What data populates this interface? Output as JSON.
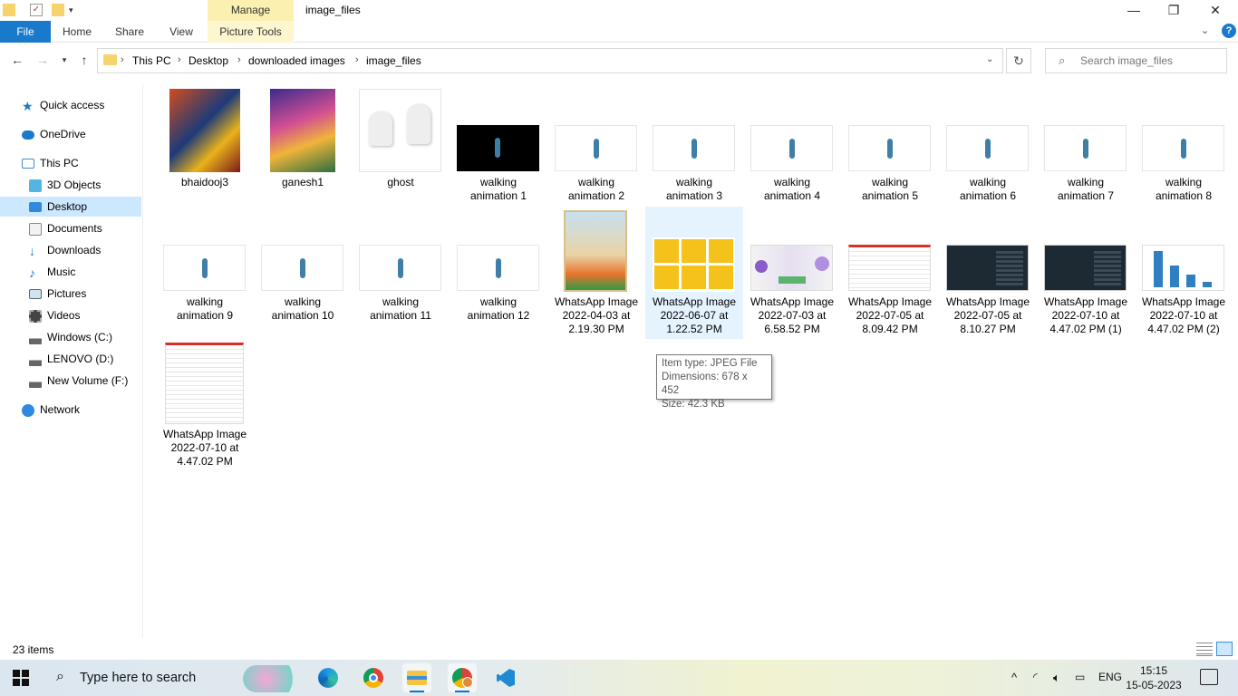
{
  "titlebar": {
    "contextual_tab": "Manage",
    "window_title": "image_files",
    "minimize_glyph": "—",
    "maximize_glyph": "❐",
    "close_glyph": "✕"
  },
  "ribbon": {
    "file": "File",
    "home": "Home",
    "share": "Share",
    "view": "View",
    "picture_tools": "Picture Tools",
    "help_glyph": "?"
  },
  "address": {
    "crumbs": [
      "This PC",
      "Desktop",
      "downloaded images",
      "image_files"
    ],
    "sep": "›"
  },
  "search": {
    "placeholder": "Search image_files"
  },
  "navpane": {
    "quick_access": "Quick access",
    "onedrive": "OneDrive",
    "this_pc": "This PC",
    "objects_3d": "3D Objects",
    "desktop": "Desktop",
    "documents": "Documents",
    "downloads": "Downloads",
    "music": "Music",
    "pictures": "Pictures",
    "videos": "Videos",
    "drive_c": "Windows (C:)",
    "drive_d": "LENOVO (D:)",
    "drive_f": "New Volume (F:)",
    "network": "Network"
  },
  "files": [
    {
      "l1": "bhaidooj3",
      "l2": "",
      "l3": ""
    },
    {
      "l1": "ganesh1",
      "l2": "",
      "l3": ""
    },
    {
      "l1": "ghost",
      "l2": "",
      "l3": ""
    },
    {
      "l1": "walking",
      "l2": "animation 1",
      "l3": ""
    },
    {
      "l1": "walking",
      "l2": "animation 2",
      "l3": ""
    },
    {
      "l1": "walking",
      "l2": "animation 3",
      "l3": ""
    },
    {
      "l1": "walking",
      "l2": "animation 4",
      "l3": ""
    },
    {
      "l1": "walking",
      "l2": "animation 5",
      "l3": ""
    },
    {
      "l1": "walking",
      "l2": "animation 6",
      "l3": ""
    },
    {
      "l1": "walking",
      "l2": "animation 7",
      "l3": ""
    },
    {
      "l1": "walking",
      "l2": "animation 8",
      "l3": ""
    },
    {
      "l1": "walking",
      "l2": "animation 9",
      "l3": ""
    },
    {
      "l1": "walking",
      "l2": "animation 10",
      "l3": ""
    },
    {
      "l1": "walking",
      "l2": "animation 11",
      "l3": ""
    },
    {
      "l1": "walking",
      "l2": "animation 12",
      "l3": ""
    },
    {
      "l1": "WhatsApp Image",
      "l2": "2022-04-03 at",
      "l3": "2.19.30 PM"
    },
    {
      "l1": "WhatsApp Image",
      "l2": "2022-06-07 at",
      "l3": "1.22.52 PM"
    },
    {
      "l1": "WhatsApp Image",
      "l2": "2022-07-03 at",
      "l3": "6.58.52 PM"
    },
    {
      "l1": "WhatsApp Image",
      "l2": "2022-07-05 at",
      "l3": "8.09.42 PM"
    },
    {
      "l1": "WhatsApp Image",
      "l2": "2022-07-05 at",
      "l3": "8.10.27 PM"
    },
    {
      "l1": "WhatsApp Image",
      "l2": "2022-07-10 at",
      "l3": "4.47.02 PM (1)"
    },
    {
      "l1": "WhatsApp Image",
      "l2": "2022-07-10 at",
      "l3": "4.47.02 PM (2)"
    },
    {
      "l1": "WhatsApp Image",
      "l2": "2022-07-10 at",
      "l3": "4.47.02 PM"
    }
  ],
  "tooltip": {
    "type": "Item type: JPEG File",
    "dimensions": "Dimensions: 678 x 452",
    "size": "Size: 42.3 KB"
  },
  "status": {
    "item_count": "23 items"
  },
  "taskbar": {
    "search_placeholder": "Type here to search",
    "lang": "ENG",
    "time": "15:15",
    "date": "15-05-2023"
  },
  "colors": {
    "accent": "#1979ca",
    "selection": "#cce8ff",
    "hover": "#e5f3ff",
    "manage_tab": "#fbf0b0"
  }
}
